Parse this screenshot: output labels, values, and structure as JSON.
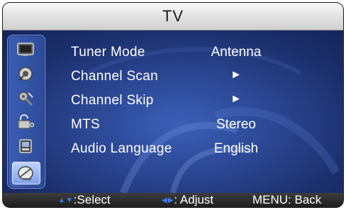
{
  "title": "TV",
  "sidebar": {
    "icons": [
      "picture-icon",
      "sound-icon",
      "settings-icon",
      "lock-icon",
      "setup-icon",
      "channel-icon"
    ],
    "active": "channel-icon"
  },
  "menu": {
    "items": [
      {
        "label": "Tuner Mode",
        "value": "Antenna"
      },
      {
        "label": "Channel Scan",
        "value": "►"
      },
      {
        "label": "Channel Skip",
        "value": "►"
      },
      {
        "label": "MTS",
        "value": "Stereo"
      },
      {
        "label": "Audio Language",
        "value": "English"
      }
    ]
  },
  "footer": {
    "select_arrows": "▲▼",
    "select_label": ":Select",
    "adjust_arrows": "◀▶",
    "adjust_label": ": Adjust",
    "menu_label": "MENU: Back"
  },
  "colors": {
    "panel": "#2b4692",
    "accent": "#3b7bff",
    "text": "#ffffff"
  }
}
